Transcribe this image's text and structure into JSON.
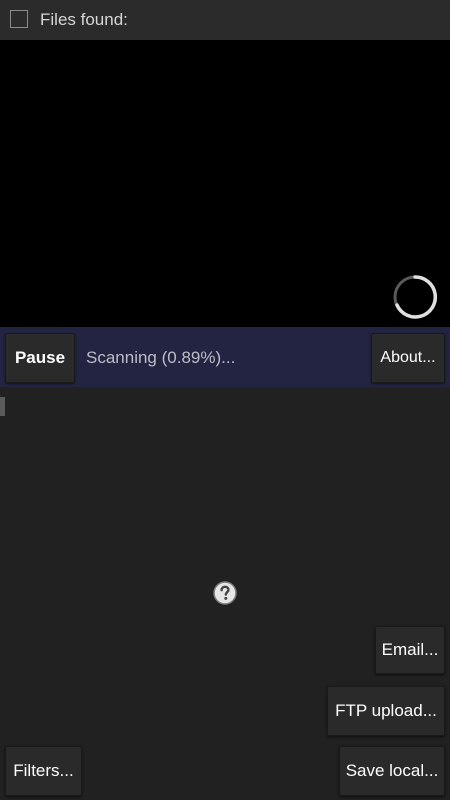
{
  "header": {
    "title": "Files found:",
    "select_all_checked": false
  },
  "preview": {
    "loading": true,
    "spinner_icon": "loading-spinner-icon"
  },
  "status_bar": {
    "pause_label": "Pause",
    "status_text": "Scanning (0.89%)...",
    "scan_progress_percent": 0.89,
    "about_label": "About..."
  },
  "main": {
    "help_icon": "question-mark-icon"
  },
  "actions": {
    "email_label": "Email...",
    "ftp_label": "FTP upload...",
    "filters_label": "Filters...",
    "save_label": "Save local..."
  },
  "colors": {
    "background": "#212121",
    "header_background": "#2b2b2b",
    "preview_background": "#000000",
    "status_bar_background": "#232442",
    "button_background": "#2a2a2a"
  }
}
